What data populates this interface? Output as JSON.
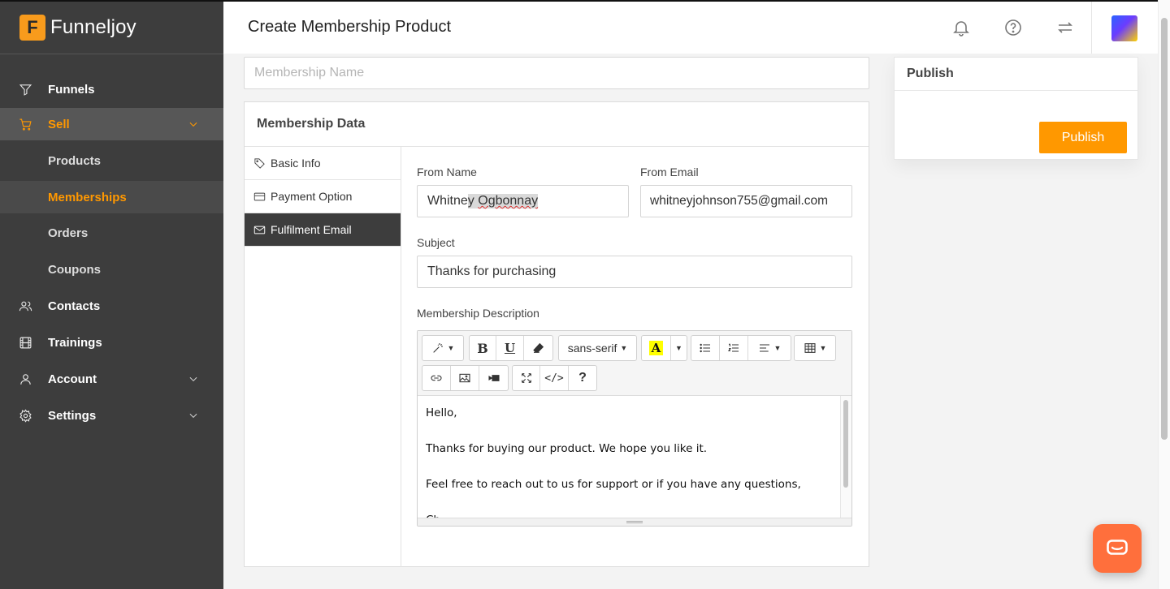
{
  "brand": {
    "logo_letter": "F",
    "name": "Funneljoy"
  },
  "sidebar": {
    "items": [
      {
        "label": "Funnels",
        "icon": "filter-icon"
      },
      {
        "label": "Sell",
        "icon": "cart-icon",
        "active": true,
        "expanded": true,
        "children": [
          {
            "label": "Products"
          },
          {
            "label": "Memberships",
            "active": true
          },
          {
            "label": "Orders"
          },
          {
            "label": "Coupons"
          }
        ]
      },
      {
        "label": "Contacts",
        "icon": "users-icon"
      },
      {
        "label": "Trainings",
        "icon": "film-icon"
      },
      {
        "label": "Account",
        "icon": "user-icon",
        "has_children": true
      },
      {
        "label": "Settings",
        "icon": "gear-icon",
        "has_children": true
      }
    ]
  },
  "header": {
    "title": "Create Membership Product"
  },
  "membership_name": {
    "placeholder": "Membership Name",
    "value": ""
  },
  "membership_data": {
    "title": "Membership Data",
    "tabs": [
      {
        "label": "Basic Info",
        "icon": "tag-icon"
      },
      {
        "label": "Payment Option",
        "icon": "credit-card-icon"
      },
      {
        "label": "Fulfilment Email",
        "icon": "mail-icon",
        "active": true
      }
    ],
    "from_name": {
      "label": "From Name",
      "value_a": "Whitne",
      "value_b": "y ",
      "value_c": "Ogbonnay"
    },
    "from_email": {
      "label": "From Email",
      "value": "whitneyjohnson755@gmail.com"
    },
    "subject": {
      "label": "Subject",
      "value": "Thanks for purchasing"
    },
    "description": {
      "label": "Membership Description",
      "font_name": "sans-serif",
      "body": [
        "Hello,",
        "",
        "Thanks for buying our product. We hope you like it.",
        "",
        "Feel free to reach out to us for support or if you have any questions,",
        "",
        "Ch"
      ]
    }
  },
  "publish": {
    "title": "Publish",
    "button_label": "Publish"
  },
  "colors": {
    "accent": "#ff9800",
    "sidebar_bg": "#3d3d3d",
    "chat": "#ff6f3c"
  }
}
